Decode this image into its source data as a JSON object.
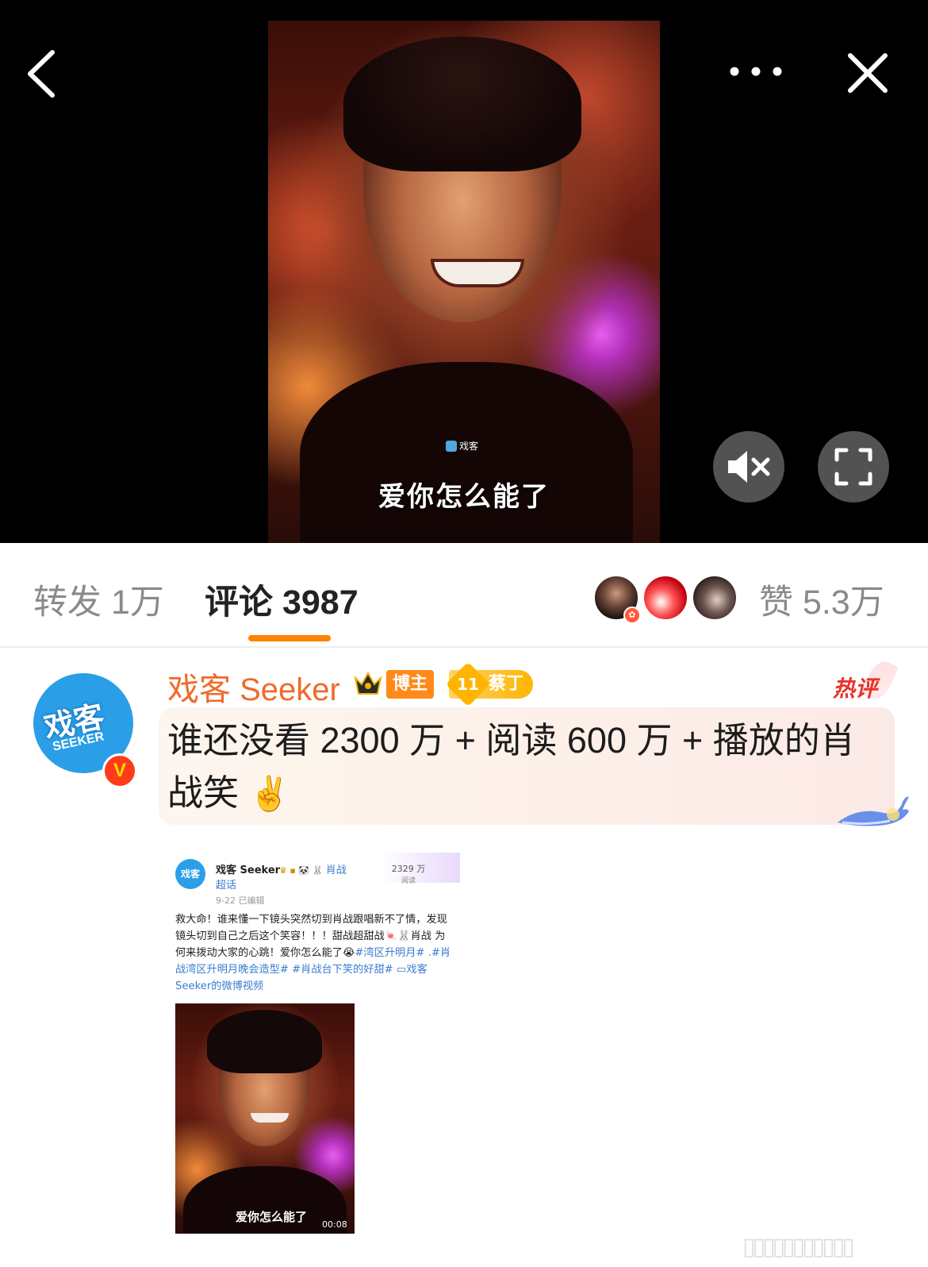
{
  "video": {
    "subtitle": "爱你怎么能了",
    "watermark": "戏客"
  },
  "icons": {
    "back": "chevron-left-icon",
    "more": "more-dots-icon",
    "close": "close-icon",
    "mute": "volume-mute-icon",
    "fullscreen": "fullscreen-icon"
  },
  "stats": {
    "repost_label": "转发 1万",
    "comments_label": "评论 3987",
    "likes_label": "赞 5.3万"
  },
  "comment": {
    "author": "戏客 Seeker",
    "blogger_badge": "博主",
    "fan_level": "11",
    "fan_badge": "蔡丁",
    "hot_label": "热评",
    "text": "谁还没看 2300 万 + 阅读 600 万 + 播放的肖战笑",
    "emoji": "✌",
    "avatar_text": "戏客",
    "avatar_subtext": "SEEKER",
    "verified": "V"
  },
  "embed": {
    "avatar_text": "戏客",
    "author": "戏客 Seeker",
    "topic_line1": "肖战",
    "topic_line2": "超话",
    "date": "9-22   已编辑",
    "reads_value": "2329 万",
    "reads_label": "阅读",
    "body_plain": "救大命！谁来懂一下镜头突然切到肖战跟唱新不了情，发现镜头切到自己之后这个笑容！！！甜战超甜战🍬🐰肖战 为何来拨动大家的心跳！爱你怎么能了😭",
    "body_links": "#湾区升明月# .#肖战湾区升明月晚会造型# #肖战台下笑的好甜# ▭戏客 Seeker的微博视频",
    "image_subtitle": "爱你怎么能了",
    "image_duration": "00:08"
  },
  "colors": {
    "accent_orange": "#ff8200",
    "author_orange": "#f06a2a",
    "hot_red": "#e8322c",
    "link_blue": "#3a7dcf"
  }
}
